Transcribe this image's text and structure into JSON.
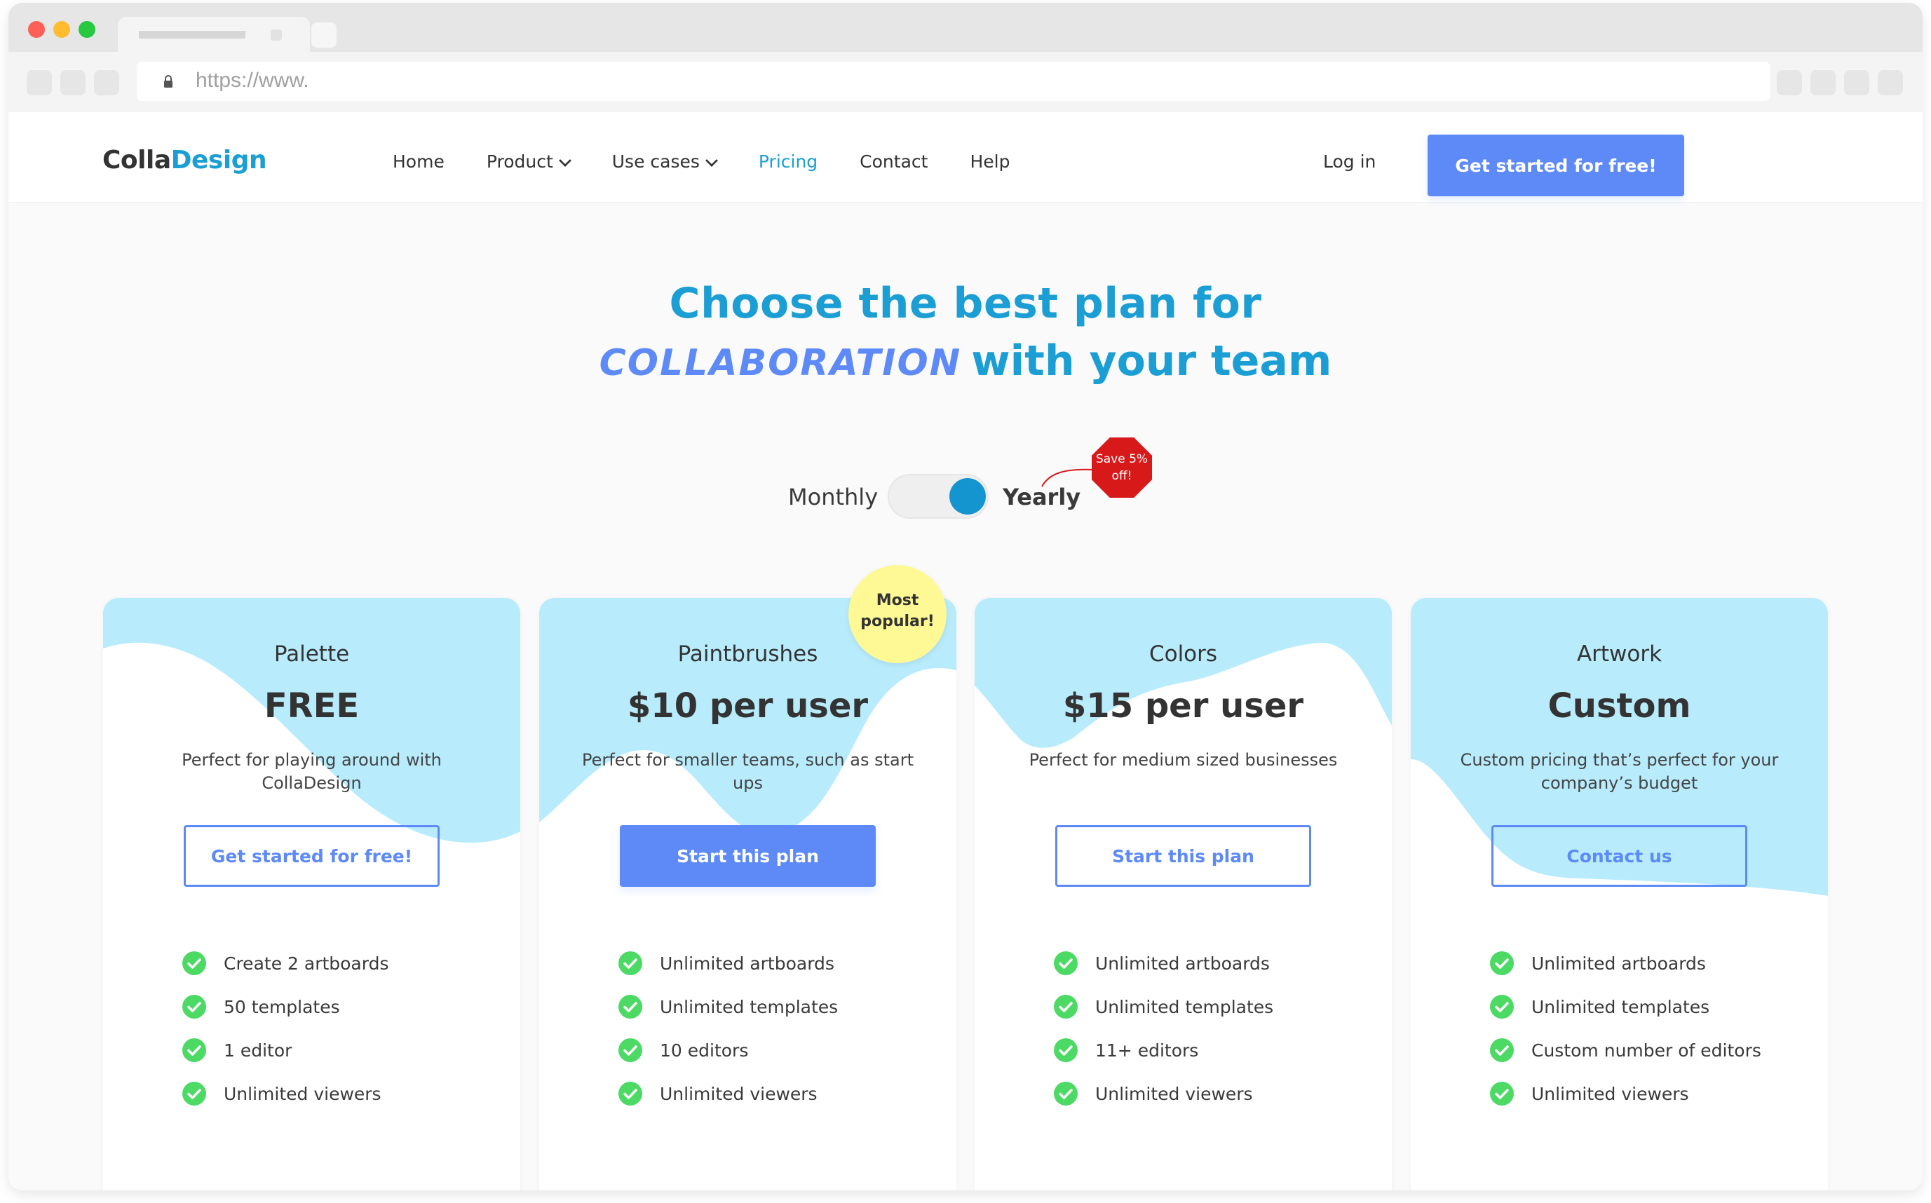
{
  "browser": {
    "url": "https://www.",
    "lock_icon": "lock-icon"
  },
  "site": {
    "logo_part1": "Colla",
    "logo_part2": "Design",
    "nav": [
      {
        "label": "Home",
        "dropdown": false,
        "active": false
      },
      {
        "label": "Product",
        "dropdown": true,
        "active": false
      },
      {
        "label": "Use cases",
        "dropdown": true,
        "active": false
      },
      {
        "label": "Pricing",
        "dropdown": false,
        "active": true
      },
      {
        "label": "Contact",
        "dropdown": false,
        "active": false
      },
      {
        "label": "Help",
        "dropdown": false,
        "active": false
      }
    ],
    "login_label": "Log in",
    "cta_label": "Get started for free!"
  },
  "hero": {
    "line1": "Choose the best plan for",
    "highlight": "COLLABORATION",
    "line2_rest": "with your team"
  },
  "billing": {
    "monthly_label": "Monthly",
    "yearly_label": "Yearly",
    "selected": "Yearly",
    "save_badge": "Save 5% off!"
  },
  "popular_badge": "Most popular!",
  "plans": [
    {
      "name": "Palette",
      "price": "FREE",
      "description": "Perfect for playing around with CollaDesign",
      "button_label": "Get started for free!",
      "button_style": "outline",
      "features": [
        "Create 2 artboards",
        "50 templates",
        "1 editor",
        "Unlimited viewers"
      ]
    },
    {
      "name": "Paintbrushes",
      "price": "$10 per user",
      "description": "Perfect for smaller teams, such as start ups",
      "button_label": "Start this plan",
      "button_style": "solid",
      "most_popular": true,
      "features": [
        "Unlimited artboards",
        "Unlimited templates",
        "10 editors",
        "Unlimited viewers"
      ]
    },
    {
      "name": "Colors",
      "price": "$15 per user",
      "description": "Perfect for medium sized businesses",
      "button_label": "Start this plan",
      "button_style": "outline",
      "features": [
        "Unlimited artboards",
        "Unlimited templates",
        "11+ editors",
        "Unlimited viewers"
      ]
    },
    {
      "name": "Artwork",
      "price": "Custom",
      "description": "Custom pricing that’s perfect for your company’s budget",
      "button_label": "Contact us",
      "button_style": "outline",
      "features": [
        "Unlimited artboards",
        "Unlimited templates",
        "Custom number of editors",
        "Unlimited viewers"
      ]
    }
  ],
  "colors": {
    "brand_blue": "#1a9ed4",
    "button_blue": "#5d8af6",
    "wave_blue": "#b8ecfd",
    "check_green": "#4cd964",
    "badge_yellow": "#fef994",
    "save_red": "#d8191a"
  }
}
